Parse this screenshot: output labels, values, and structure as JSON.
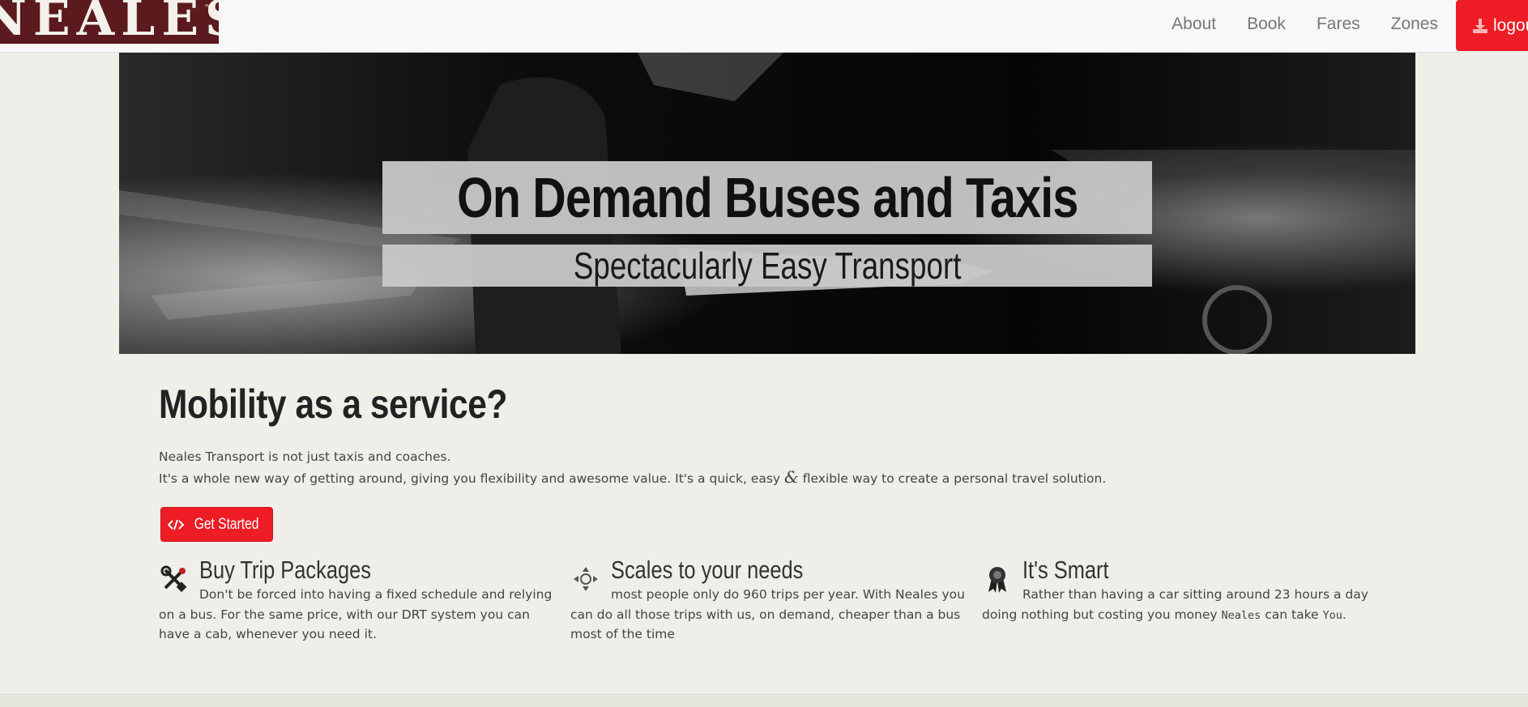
{
  "brand": {
    "name": "NEALES",
    "tm": "™"
  },
  "nav": {
    "items": [
      "About",
      "Book",
      "Fares",
      "Zones"
    ],
    "logout_label": "logout"
  },
  "hero": {
    "title": "On Demand Buses and Taxis",
    "subtitle": "Spectacularly Easy Transport"
  },
  "main": {
    "heading": "Mobility as a service?",
    "intro_line1": "Neales Transport is not just taxis and coaches.",
    "intro_line2a": "It's a whole new way of getting around, giving you flexibility and awesome value. It's a quick, easy",
    "intro_amp": "&",
    "intro_line2b": "flexible way to create a personal travel solution.",
    "cta_label": "Get Started",
    "cta_icon": "code-icon"
  },
  "features": [
    {
      "title": "Buy Trip Packages",
      "icon": "tools-icon",
      "text": "Don't be forced into having a fixed schedule and relying on a bus. For the same price, with our DRT system you can have a cab, whenever you need it."
    },
    {
      "title": "Scales to your needs",
      "icon": "move-arrows-icon",
      "text": "most people only do 960 trips per year. With Neales you can do all those trips with us, on demand, cheaper than a bus most of the time"
    },
    {
      "title": "It's Smart",
      "icon": "award-ribbon-icon",
      "text_a": "Rather than having a car sitting around 23 hours a day doing nothing but costing you money",
      "mono_a": "Neales",
      "text_b": "can take",
      "mono_b": "You",
      "text_c": "."
    }
  ],
  "colors": {
    "accent": "#ee1c24",
    "brand_bg": "#5a1a1e",
    "page_bg": "#efeee8"
  }
}
